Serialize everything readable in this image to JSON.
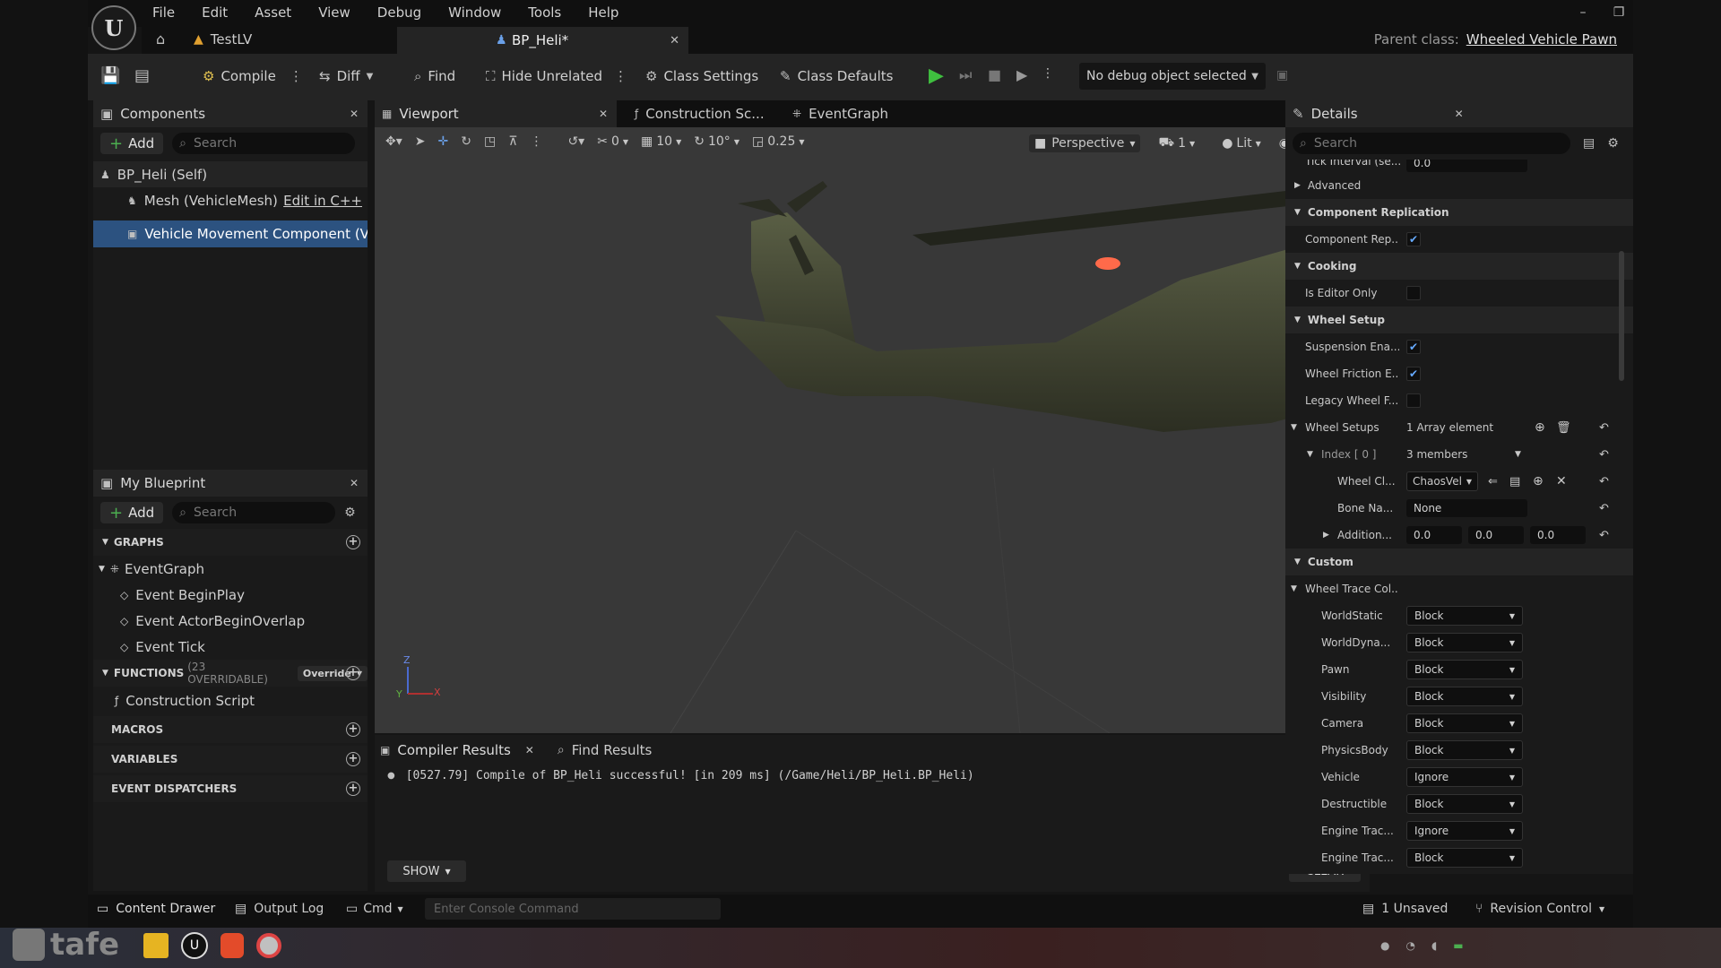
{
  "menu": [
    "File",
    "Edit",
    "Asset",
    "View",
    "Debug",
    "Window",
    "Tools",
    "Help"
  ],
  "tabs": {
    "level_tab": "TestLV",
    "bp_tab": "BP_Heli*"
  },
  "parent_class": {
    "label": "Parent class:",
    "value": "Wheeled Vehicle Pawn"
  },
  "toolbar": {
    "compile": "Compile",
    "diff": "Diff",
    "find": "Find",
    "hide_unrelated": "Hide Unrelated",
    "class_settings": "Class Settings",
    "class_defaults": "Class Defaults",
    "debug_object": "No debug object selected"
  },
  "components": {
    "title": "Components",
    "add": "Add",
    "search_placeholder": "Search",
    "items": [
      {
        "label": "BP_Heli (Self)"
      },
      {
        "label": "Mesh (VehicleMesh)",
        "extra": "Edit in C++"
      },
      {
        "label": "Vehicle Movement Component (Vehi"
      }
    ]
  },
  "my_blueprint": {
    "title": "My Blueprint",
    "add": "Add",
    "search_placeholder": "Search",
    "graphs": "GRAPHS",
    "event_graph": "EventGraph",
    "events": [
      "Event BeginPlay",
      "Event ActorBeginOverlap",
      "Event Tick"
    ],
    "functions": "FUNCTIONS",
    "functions_count": "(23 OVERRIDABLE)",
    "override": "Override",
    "construction_script": "Construction Script",
    "macros": "MACROS",
    "variables": "VARIABLES",
    "event_dispatchers": "EVENT DISPATCHERS"
  },
  "editor_tabs": {
    "viewport": "Viewport",
    "construction": "Construction Sc...",
    "eventgraph": "EventGraph"
  },
  "viewport_toolbar": {
    "rot_snap": "0",
    "grid": "10",
    "angle": "10°",
    "scale": "0.25",
    "perspective": "Perspective",
    "cam_speed": "1",
    "lit": "Lit"
  },
  "axis": {
    "z": "Z",
    "x": "X",
    "y": "Y"
  },
  "compiler": {
    "tab": "Compiler Results",
    "find_tab": "Find Results",
    "message": "[0527.79] Compile of BP_Heli successful! [in 209 ms] (/Game/Heli/BP_Heli.BP_Heli)",
    "show": "SHOW",
    "clear": "CLEAR"
  },
  "details": {
    "title": "Details",
    "search_placeholder": "Search",
    "tick_interval": {
      "label": "Tick Interval (se...",
      "value": "0.0"
    },
    "advanced": "Advanced",
    "cat_replication": "Component Replication",
    "replicates": {
      "label": "Component Rep...",
      "checked": true
    },
    "cat_cooking": "Cooking",
    "editor_only": {
      "label": "Is Editor Only",
      "checked": false
    },
    "cat_wheel_setup": "Wheel Setup",
    "suspension": {
      "label": "Suspension Ena...",
      "checked": true
    },
    "friction": {
      "label": "Wheel Friction E...",
      "checked": true
    },
    "legacy": {
      "label": "Legacy Wheel F...",
      "checked": false
    },
    "wheel_setups": {
      "label": "Wheel Setups",
      "value": "1 Array element"
    },
    "index0": {
      "label": "Index [ 0 ]",
      "value": "3 members"
    },
    "wheel_class": {
      "label": "Wheel Cl...",
      "value": "ChaosVel"
    },
    "bone_name": {
      "label": "Bone Na...",
      "value": "None"
    },
    "additional": {
      "label": "Addition...",
      "x": "0.0",
      "y": "0.0",
      "z": "0.0"
    },
    "cat_custom": "Custom",
    "trace": {
      "label": "Wheel Trace Col..."
    },
    "channels": [
      {
        "label": "WorldStatic",
        "value": "Block"
      },
      {
        "label": "WorldDyna...",
        "value": "Block"
      },
      {
        "label": "Pawn",
        "value": "Block"
      },
      {
        "label": "Visibility",
        "value": "Block"
      },
      {
        "label": "Camera",
        "value": "Block"
      },
      {
        "label": "PhysicsBody",
        "value": "Block"
      },
      {
        "label": "Vehicle",
        "value": "Ignore"
      },
      {
        "label": "Destructible",
        "value": "Block"
      },
      {
        "label": "Engine Trac...",
        "value": "Ignore"
      },
      {
        "label": "Engine Trac...",
        "value": "Block"
      }
    ]
  },
  "statusbar": {
    "content_drawer": "Content Drawer",
    "output_log": "Output Log",
    "cmd": "Cmd",
    "console_placeholder": "Enter Console Command",
    "unsaved": "1 Unsaved",
    "revision": "Revision Control"
  },
  "watermark": "tafe"
}
